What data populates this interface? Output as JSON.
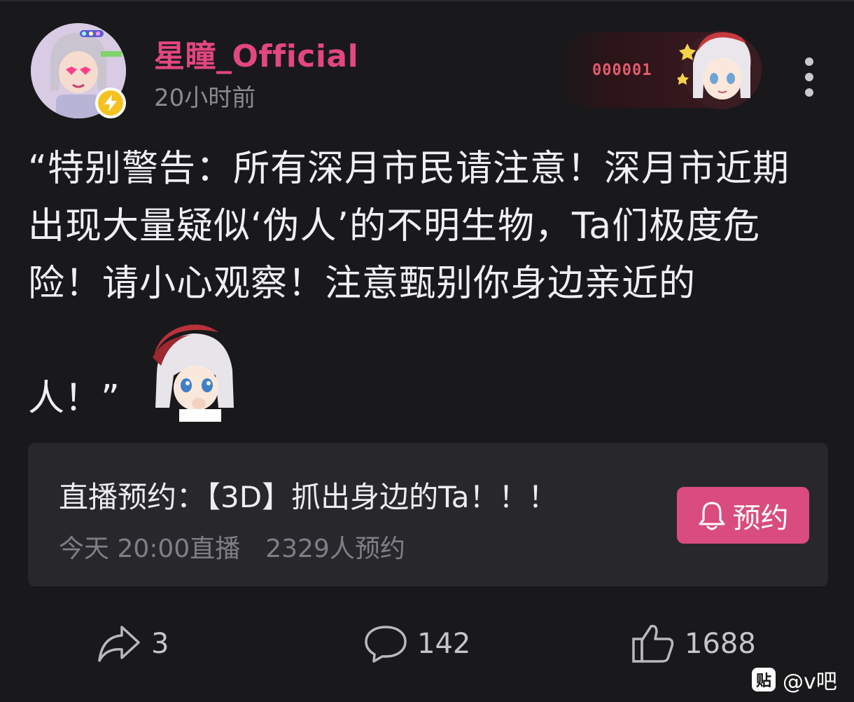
{
  "post": {
    "author": "星瞳_Official",
    "time": "20小时前",
    "fan_badge_number": "000001",
    "text": "“特别警告：所有深月市民请注意！深月市近期出现大量疑似‘伪人’的不明生物，Ta们极度危险！请小心观察！注意甄别你身边亲近的",
    "text_end": "人！”",
    "icons": {
      "avatar": "avatar-image",
      "verified": "lightning-icon",
      "sticker": "sticker-image",
      "more": "more-vertical-icon"
    }
  },
  "live_card": {
    "title": "直播预约：【3D】抓出身边的Ta！！！",
    "time": "今天 20:00直播",
    "reservations": "2329人预约",
    "button_label": "预约",
    "button_icon": "bell-icon",
    "button_color": "#d94c7d"
  },
  "actions": {
    "share_count": "3",
    "comment_count": "142",
    "like_count": "1688"
  },
  "watermark": {
    "icon_text": "贴",
    "text": "@v吧"
  },
  "colors": {
    "background": "#19191b",
    "username": "#e2477d",
    "card": "#28282c"
  }
}
